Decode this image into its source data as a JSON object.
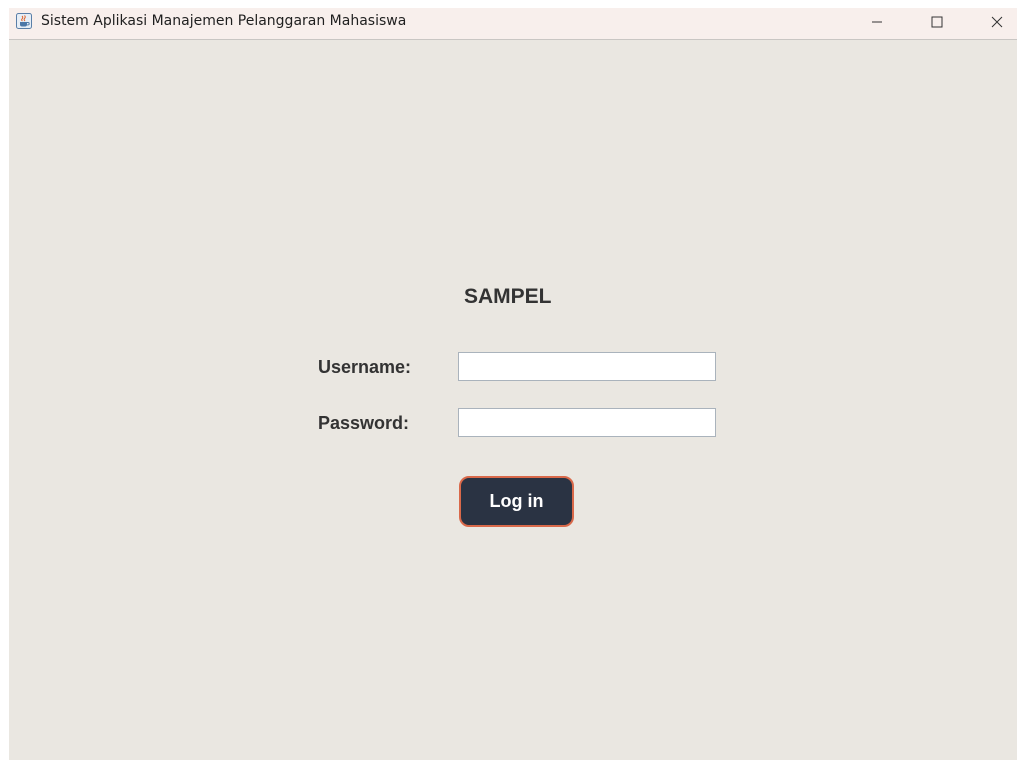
{
  "window": {
    "title": "Sistem Aplikasi Manajemen Pelanggaran Mahasiswa",
    "icon": "java-coffee-icon",
    "controls": [
      "minimize-icon",
      "maximize-icon",
      "close-icon"
    ]
  },
  "form": {
    "heading": "SAMPEL",
    "username_label": "Username:",
    "username_value": "",
    "password_label": "Password:",
    "password_value": "",
    "login_label": "Log in"
  },
  "colors": {
    "background": "#eae7e1",
    "titlebar": "#f8efec",
    "button_bg": "#2a3343",
    "button_border": "#d9694a",
    "text": "#333333"
  }
}
